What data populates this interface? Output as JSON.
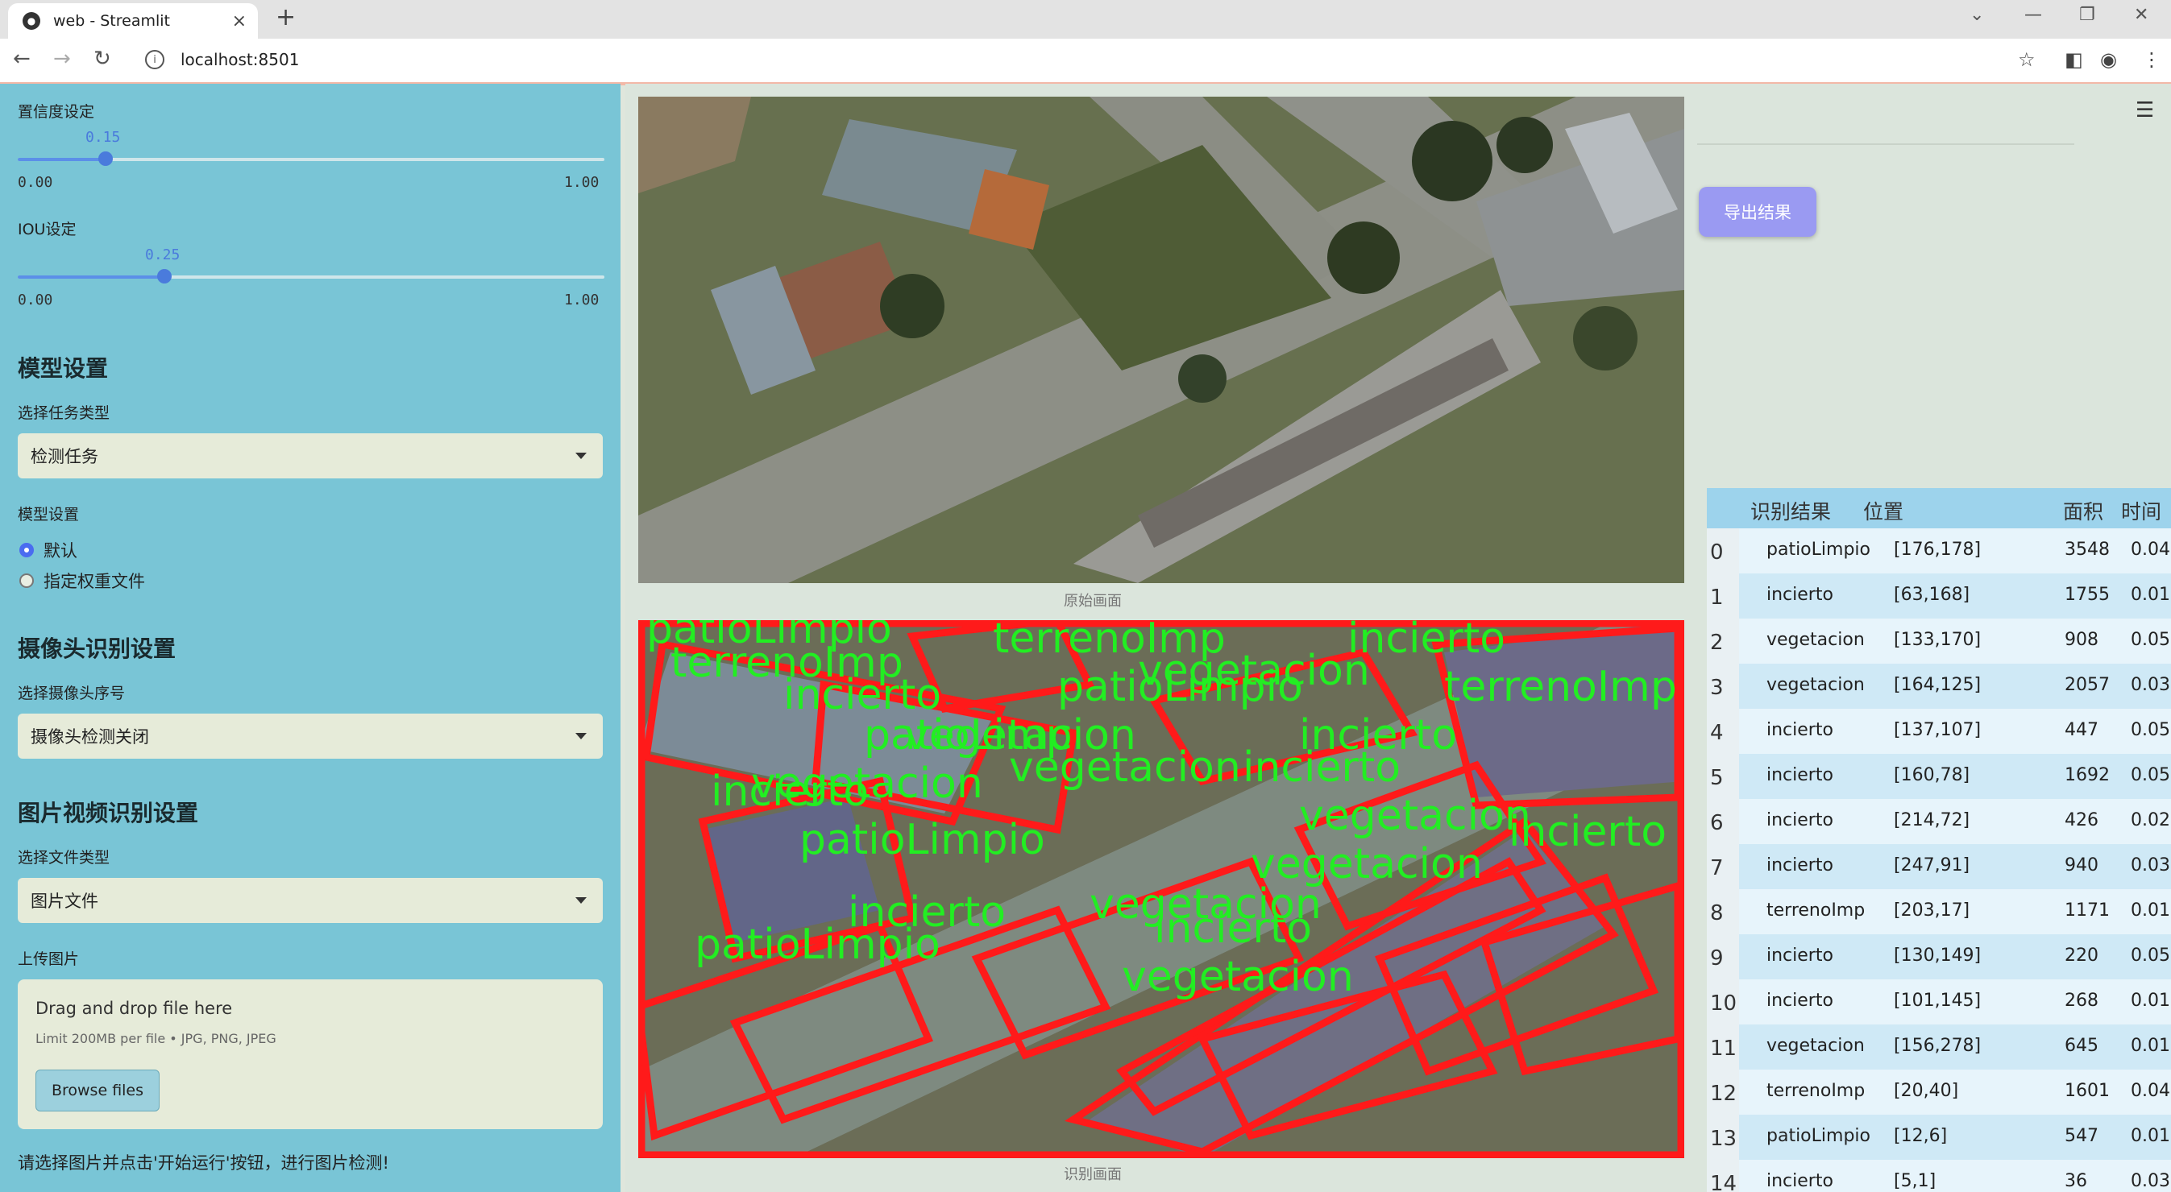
{
  "browser": {
    "tab_title": "web - Streamlit",
    "new_tab_symbol": "+",
    "close_symbol": "×",
    "url": "localhost:8501",
    "icons": [
      "back-icon",
      "forward-icon",
      "reload-icon",
      "info-icon",
      "star-icon",
      "sidebar-toggle-icon",
      "profile-icon",
      "menu-dots-icon",
      "minimize-icon",
      "maximize-icon",
      "close-icon",
      "tab-list-icon"
    ]
  },
  "sidebar": {
    "confidence": {
      "label": "置信度设定",
      "value": "0.15",
      "min": "0.00",
      "max": "1.00",
      "fraction": 0.15
    },
    "iou": {
      "label": "IOU设定",
      "value": "0.25",
      "min": "0.00",
      "max": "1.00",
      "fraction": 0.25
    },
    "model_section": "模型设置",
    "task_label": "选择任务类型",
    "task_value": "检测任务",
    "model_label": "模型设置",
    "model_options": [
      {
        "label": "默认",
        "selected": true
      },
      {
        "label": "指定权重文件",
        "selected": false
      }
    ],
    "camera_section": "摄像头识别设置",
    "camera_label": "选择摄像头序号",
    "camera_value": "摄像头检测关闭",
    "media_section": "图片视频识别设置",
    "filetype_label": "选择文件类型",
    "filetype_value": "图片文件",
    "upload_label": "上传图片",
    "upload_title": "Drag and drop file here",
    "upload_limit": "Limit 200MB per file • JPG, PNG, JPEG",
    "browse_label": "Browse files",
    "hint": "请选择图片并点击'开始运行'按钮，进行图片检测!"
  },
  "main": {
    "original_caption": "原始画面",
    "result_caption": "识别画面",
    "export_label": "导出结果",
    "overlay_labels": [
      "patioLimpio",
      "terrenoImp",
      "terrenoImp",
      "incierto",
      "vegetacion",
      "patioLimpio",
      "incierto",
      "patioLimpio",
      "vegetacion",
      "incierto",
      "vegetacion",
      "incierto",
      "patioLimpio",
      "vegetacion",
      "incierto",
      "terrenoImp",
      "vegetacion",
      "incierto",
      "vegetacion",
      "patioLimpio",
      "incierto",
      "vegetacion",
      "incierto",
      "vegetacion"
    ]
  },
  "results": {
    "headers": [
      "识别结果",
      "位置",
      "面积",
      "时间"
    ],
    "rows": [
      {
        "idx": "0",
        "label": "patioLimpio",
        "pos": "[176,178]",
        "area": "3548",
        "time": "0.04"
      },
      {
        "idx": "1",
        "label": "incierto",
        "pos": "[63,168]",
        "area": "1755",
        "time": "0.01"
      },
      {
        "idx": "2",
        "label": "vegetacion",
        "pos": "[133,170]",
        "area": "908",
        "time": "0.05"
      },
      {
        "idx": "3",
        "label": "vegetacion",
        "pos": "[164,125]",
        "area": "2057",
        "time": "0.03"
      },
      {
        "idx": "4",
        "label": "incierto",
        "pos": "[137,107]",
        "area": "447",
        "time": "0.05"
      },
      {
        "idx": "5",
        "label": "incierto",
        "pos": "[160,78]",
        "area": "1692",
        "time": "0.05"
      },
      {
        "idx": "6",
        "label": "incierto",
        "pos": "[214,72]",
        "area": "426",
        "time": "0.02"
      },
      {
        "idx": "7",
        "label": "incierto",
        "pos": "[247,91]",
        "area": "940",
        "time": "0.03"
      },
      {
        "idx": "8",
        "label": "terrenoImp",
        "pos": "[203,17]",
        "area": "1171",
        "time": "0.01"
      },
      {
        "idx": "9",
        "label": "incierto",
        "pos": "[130,149]",
        "area": "220",
        "time": "0.05"
      },
      {
        "idx": "10",
        "label": "incierto",
        "pos": "[101,145]",
        "area": "268",
        "time": "0.01"
      },
      {
        "idx": "11",
        "label": "vegetacion",
        "pos": "[156,278]",
        "area": "645",
        "time": "0.01"
      },
      {
        "idx": "12",
        "label": "terrenoImp",
        "pos": "[20,40]",
        "area": "1601",
        "time": "0.04"
      },
      {
        "idx": "13",
        "label": "patioLimpio",
        "pos": "[12,6]",
        "area": "547",
        "time": "0.01"
      },
      {
        "idx": "14",
        "label": "incierto",
        "pos": "[5,1]",
        "area": "36",
        "time": "0.03"
      }
    ]
  }
}
